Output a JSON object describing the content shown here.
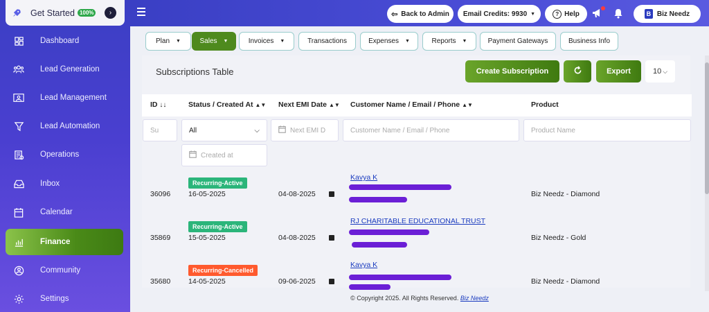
{
  "sidebar": {
    "get_started": {
      "label": "Get Started",
      "badge": "100%"
    },
    "items": [
      {
        "label": "Dashboard",
        "icon": "dashboard-icon"
      },
      {
        "label": "Lead Generation",
        "icon": "users-icon"
      },
      {
        "label": "Lead Management",
        "icon": "contact-card-icon"
      },
      {
        "label": "Lead Automation",
        "icon": "funnel-icon"
      },
      {
        "label": "Operations",
        "icon": "operations-icon"
      },
      {
        "label": "Inbox",
        "icon": "inbox-icon"
      },
      {
        "label": "Calendar",
        "icon": "calendar-icon"
      },
      {
        "label": "Finance",
        "icon": "finance-icon"
      },
      {
        "label": "Community",
        "icon": "community-icon"
      },
      {
        "label": "Settings",
        "icon": "gear-icon"
      }
    ],
    "active": "Finance"
  },
  "header": {
    "back_to_admin": "Back to Admin",
    "email_credits": "Email Credits: 9930",
    "help": "Help",
    "profile": "Biz Needz"
  },
  "tabs": [
    {
      "label": "Plan",
      "dropdown": true
    },
    {
      "label": "Sales",
      "dropdown": true,
      "active": true
    },
    {
      "label": "Invoices",
      "dropdown": true
    },
    {
      "label": "Transactions",
      "dropdown": false
    },
    {
      "label": "Expenses",
      "dropdown": true
    },
    {
      "label": "Reports",
      "dropdown": true
    },
    {
      "label": "Payment Gateways",
      "dropdown": false
    },
    {
      "label": "Business Info",
      "dropdown": false
    }
  ],
  "content": {
    "title": "Subscriptions Table",
    "create_label": "Create Subscription",
    "export_label": "Export",
    "per_page": "10"
  },
  "table": {
    "headers": [
      "ID",
      "Status / Created At",
      "Next EMI Date",
      "Customer Name / Email / Phone",
      "Product"
    ],
    "filters": {
      "id_placeholder": "Su",
      "status_value": "All",
      "created_placeholder": "Created at",
      "emi_placeholder": "Next EMI D",
      "customer_placeholder": "Customer Name / Email / Phone",
      "product_placeholder": "Product Name"
    },
    "rows": [
      {
        "id": "36096",
        "status": "Recurring-Active",
        "created": "16-05-2025",
        "next_emi": "04-08-2025",
        "customer": "Kavya K",
        "product": "Biz Needz - Diamond"
      },
      {
        "id": "35869",
        "status": "Recurring-Active",
        "created": "15-05-2025",
        "next_emi": "04-08-2025",
        "customer": "RJ CHARITABLE EDUCATIONAL TRUST",
        "product": "Biz Needz - Gold"
      },
      {
        "id": "35680",
        "status": "Recurring-Cancelled",
        "created": "14-05-2025",
        "next_emi": "09-06-2025",
        "customer": "Kavya K",
        "product": "Biz Needz - Diamond"
      }
    ]
  },
  "footer": {
    "text": "© Copyright 2025. All Rights Reserved.",
    "link": "Biz Needz"
  }
}
